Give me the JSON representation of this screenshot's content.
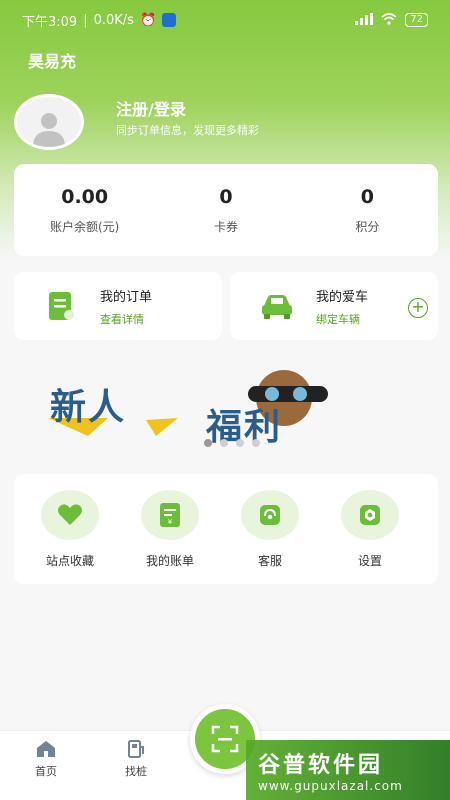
{
  "status_bar": {
    "time": "下午3:09",
    "net_speed": "0.0K/s",
    "battery": "72"
  },
  "app": {
    "title": "昊易充"
  },
  "profile": {
    "login_title": "注册/登录",
    "login_subtitle": "同步订单信息，发现更多精彩"
  },
  "stats": [
    {
      "value": "0.00",
      "label": "账户余额(元)"
    },
    {
      "value": "0",
      "label": "卡券"
    },
    {
      "value": "0",
      "label": "积分"
    }
  ],
  "quick_links": {
    "orders": {
      "title": "我的订单",
      "subtitle": "查看详情"
    },
    "car": {
      "title": "我的爱车",
      "subtitle": "绑定车辆"
    }
  },
  "banner": {
    "text_line1": "新人",
    "text_line2": "福利"
  },
  "services": [
    {
      "label": "站点收藏",
      "icon": "heart-icon"
    },
    {
      "label": "我的账单",
      "icon": "bill-icon"
    },
    {
      "label": "客服",
      "icon": "headset-icon"
    },
    {
      "label": "设置",
      "icon": "settings-icon"
    }
  ],
  "tabs": [
    {
      "label": "首页",
      "icon": "home-icon"
    },
    {
      "label": "找桩",
      "icon": "charger-icon"
    }
  ],
  "watermark": {
    "title": "谷普软件园",
    "url": "www.gupuxlazal.com"
  },
  "colors": {
    "brand": "#7cc53f",
    "accent": "#54a51f"
  }
}
